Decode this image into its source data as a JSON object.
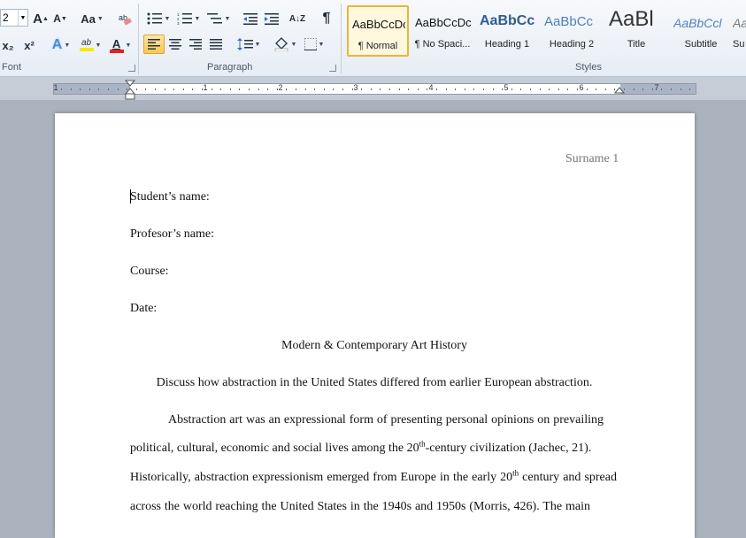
{
  "ribbon": {
    "font_size": "2",
    "groups": {
      "font": "Font",
      "paragraph": "Paragraph",
      "styles": "Styles"
    },
    "font_tools": {
      "grow": "A",
      "shrink": "A",
      "change_case": "Aa",
      "subscript": "x₂",
      "superscript": "x²",
      "text_effects": "A",
      "highlight": "ab",
      "font_color": "A",
      "highlight_color": "#f5e90d",
      "font_color_value": "#e0241b"
    },
    "paragraph_tools": {
      "sort": "A↓Z",
      "show_marks": "¶"
    },
    "styles": [
      {
        "sample": "AaBbCcDc",
        "name": "¶ Normal",
        "active": true
      },
      {
        "sample": "AaBbCcDc",
        "name": "¶ No Spaci...",
        "active": false
      },
      {
        "sample": "AaBbCc",
        "name": "Heading 1",
        "active": false
      },
      {
        "sample": "AaBbCc",
        "name": "Heading 2",
        "active": false
      },
      {
        "sample": "AaBl",
        "name": "Title",
        "active": false
      },
      {
        "sample": "AaBbCcl",
        "name": "Subtitle",
        "active": false
      },
      {
        "sample": "AaBb",
        "name": "Su",
        "active": false
      }
    ]
  },
  "ruler": {
    "numbers": [
      "1",
      "1",
      "2",
      "3",
      "4",
      "5",
      "6",
      "7"
    ]
  },
  "document": {
    "header": "Surname 1",
    "lines": {
      "student": "Student’s name:",
      "professor": "Profesor’s name:",
      "course": "Course:",
      "date": "Date:",
      "title": "Modern & Contemporary Art History",
      "prompt": "Discuss how abstraction in the United States differed from earlier European abstraction."
    },
    "body": {
      "l1": "Abstraction art was an expressional form of presenting personal opinions on prevailing",
      "l2a": "political, cultural, economic and social lives among the 20",
      "l2sup": "th",
      "l2b": "-century civilization (Jachec, 21).",
      "l3a": "Historically, abstraction expressionism emerged from Europe in the early 20",
      "l3sup": "th",
      "l3b": " century and spread",
      "l4": "across the world reaching the United States in the 1940s and 1950s (Morris, 426). The main"
    }
  },
  "colors": {
    "accent": "#fbc950",
    "page": "#ffffff",
    "workspace": "#a9b2bd"
  }
}
